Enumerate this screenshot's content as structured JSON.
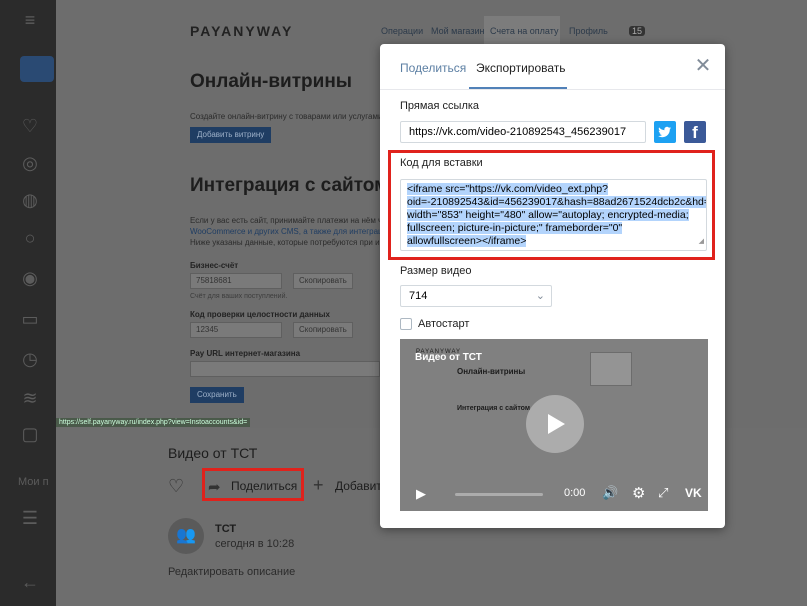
{
  "bg_page": {
    "logo": "PAYANYWAY",
    "nav": [
      "Операции",
      "Мой магазин",
      "Счета на оплату",
      "Профиль"
    ],
    "badge": "15",
    "h1": "Онлайн-витрины",
    "p1": "Создайте онлайн-витрину с товарами или услугами и д",
    "add_btn": "Добавить витрину",
    "h2": "Интеграция с сайтом",
    "p2a": "Если у вас есть сайт, принимайте платежи на нём через",
    "p2b": "WooCommerce и других CMS, а также для интеграции",
    "p2c": "Ниже указаны данные, которые потребуются при интег",
    "biz_label": "Бизнес-счёт",
    "biz_value": "75818681",
    "biz_hint": "Счёт для ваших поступлений.",
    "copy_label": "Скопировать",
    "code_label": "Код проверки целостности данных",
    "code_value": "12345",
    "payurl_label": "Pay URL интернет-магазина",
    "save_btn": "Сохранить",
    "status_url": "https://self.payanyway.ru/index.php?view=Instoaccounts&id="
  },
  "video_panel": {
    "title": "Видео от ТСТ",
    "share": "Поделиться",
    "add": "Добавить",
    "author": "ТСТ",
    "date": "сегодня в 10:28",
    "edit": "Редактировать описание"
  },
  "sidebar": {
    "my_label": "Мои п"
  },
  "modal": {
    "tab_share": "Поделиться",
    "tab_export": "Экспортировать",
    "direct_link_label": "Прямая ссылка",
    "direct_link": "https://vk.com/video-210892543_456239017",
    "embed_label": "Код для вставки",
    "embed_code": "<iframe src=\"https://vk.com/video_ext.php?oid=-210892543&id=456239017&hash=88ad2671524dcb2c&hd=2\" width=\"853\" height=\"480\" allow=\"autoplay; encrypted-media; fullscreen; picture-in-picture;\" frameborder=\"0\" allowfullscreen></iframe>",
    "size_label": "Размер видео",
    "size_value": "714",
    "autostart_label": "Автостарт",
    "preview_title": "Видео от ТСТ",
    "preview_time": "0:00",
    "preview_h1": "Онлайн-витрины",
    "preview_h2": "Интеграция с сайтом"
  },
  "colors": {
    "accent": "#5181b8",
    "highlight": "#e0221c",
    "selection": "#b3d4fc"
  }
}
